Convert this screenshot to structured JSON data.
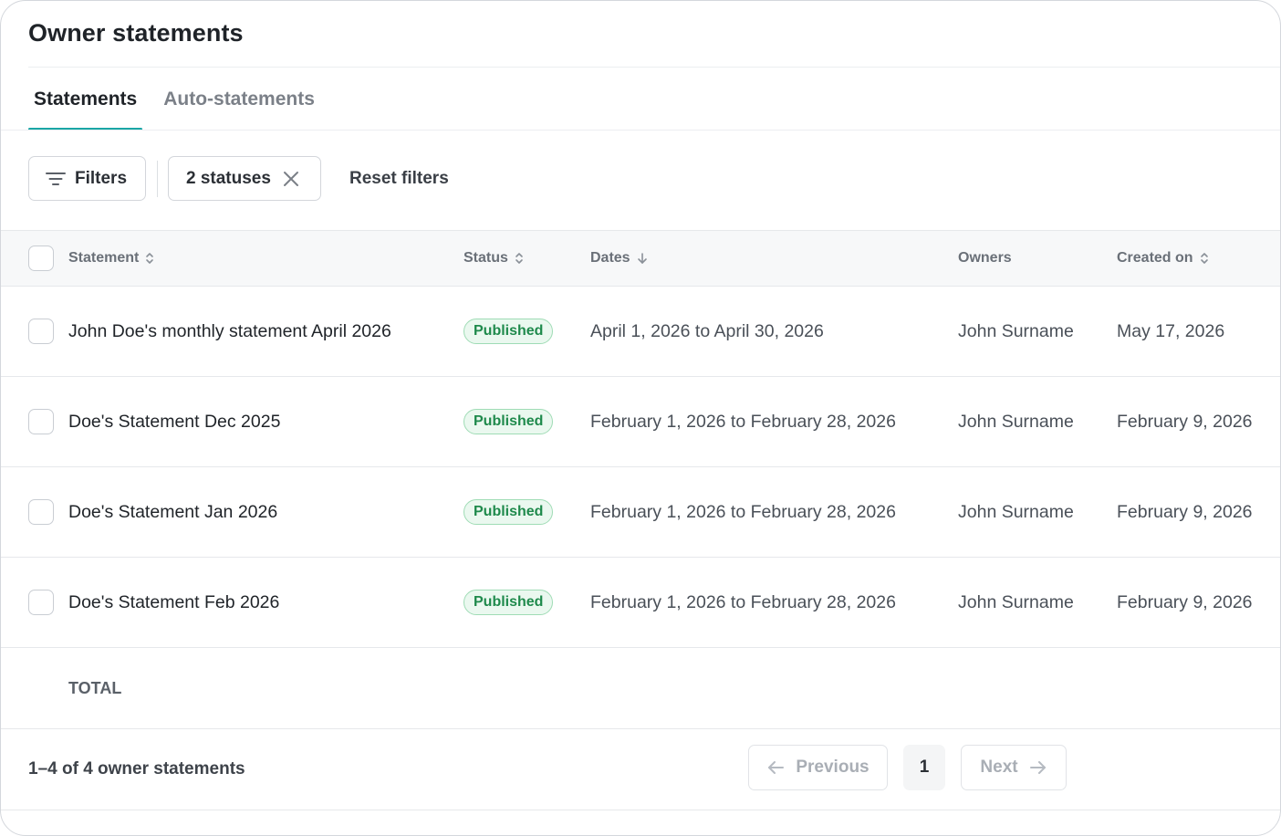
{
  "page": {
    "title": "Owner statements"
  },
  "tabs": [
    {
      "label": "Statements",
      "active": true
    },
    {
      "label": "Auto-statements",
      "active": false
    }
  ],
  "filters": {
    "filters_label": "Filters",
    "status_chip_label": "2 statuses",
    "reset_label": "Reset filters"
  },
  "table": {
    "columns": {
      "statement": "Statement",
      "status": "Status",
      "dates": "Dates",
      "owners": "Owners",
      "created_on": "Created on"
    },
    "rows": [
      {
        "statement": "John Doe's monthly statement April 2026",
        "status": "Published",
        "dates": "April 1, 2026 to April 30, 2026",
        "owners": "John Surname",
        "created_on": "May 17, 2026"
      },
      {
        "statement": "Doe's Statement Dec 2025",
        "status": "Published",
        "dates": "February 1, 2026 to February 28, 2026",
        "owners": "John Surname",
        "created_on": "February 9, 2026"
      },
      {
        "statement": "Doe's Statement Jan 2026",
        "status": "Published",
        "dates": "February 1, 2026 to February 28, 2026",
        "owners": "John Surname",
        "created_on": "February 9, 2026"
      },
      {
        "statement": "Doe's Statement Feb 2026",
        "status": "Published",
        "dates": "February 1, 2026 to February 28, 2026",
        "owners": "John Surname",
        "created_on": "February 9, 2026"
      }
    ],
    "total_label": "TOTAL"
  },
  "pagination": {
    "summary": "1–4 of 4 owner statements",
    "previous_label": "Previous",
    "current_page": "1",
    "next_label": "Next"
  },
  "colors": {
    "accent": "#1aa6a6",
    "badge_text": "#1f8a4c",
    "badge_bg": "#eaf8ef"
  }
}
